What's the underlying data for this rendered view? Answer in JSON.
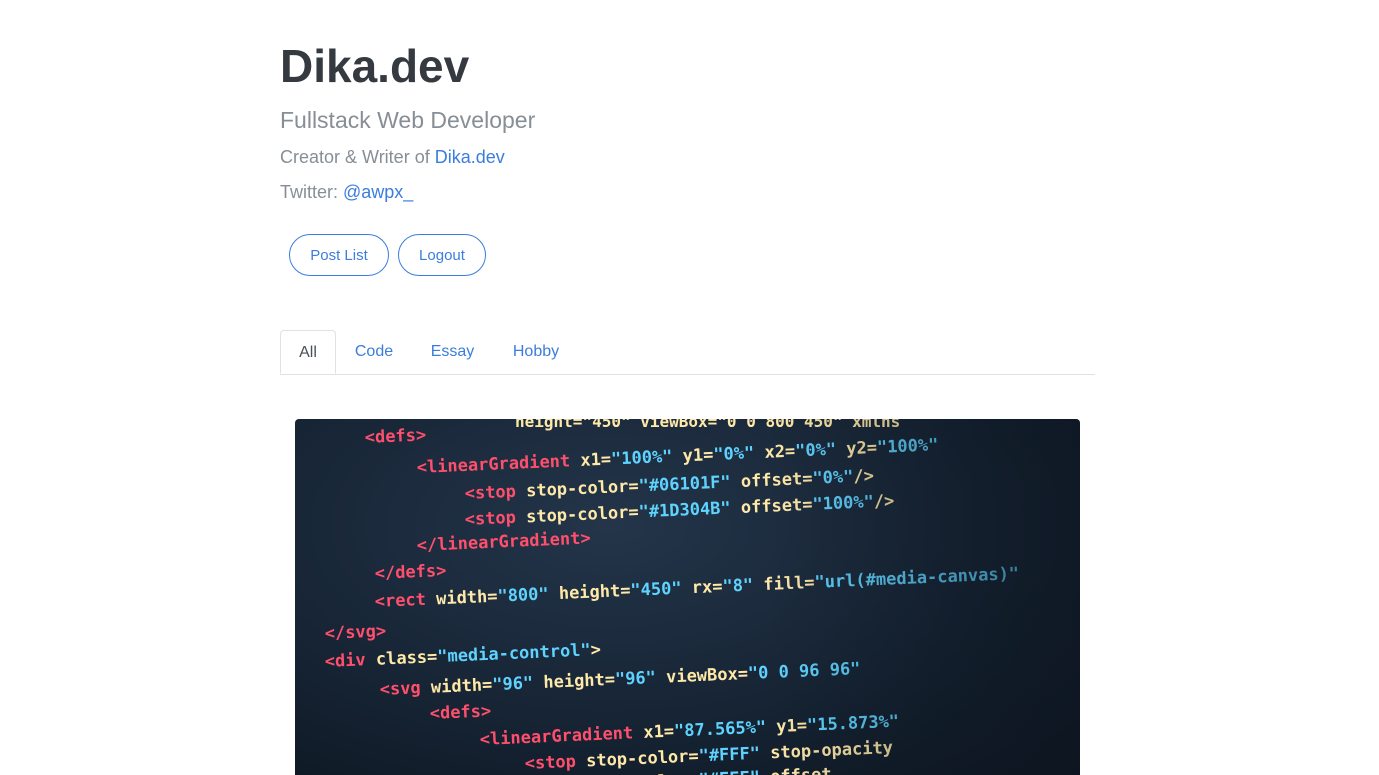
{
  "header": {
    "title": "Dika.dev",
    "subtitle": "Fullstack Web Developer",
    "creator_prefix": "Creator & Writer of ",
    "creator_link": "Dika.dev",
    "twitter_prefix": "Twitter: ",
    "twitter_handle": "@awpx_"
  },
  "buttons": {
    "post_list": "Post List",
    "logout": "Logout"
  },
  "tabs": [
    {
      "label": "All",
      "active": true
    },
    {
      "label": "Code",
      "active": false
    },
    {
      "label": "Essay",
      "active": false
    },
    {
      "label": "Hobby",
      "active": false
    }
  ],
  "post_image": {
    "lines": [
      {
        "tag": "<defs>",
        "rest": ""
      },
      {
        "tag": "<linearGradient",
        "rest": " x1=\"100%\" y1=\"0%\" x2=\"0%\" y2=\"100%\""
      },
      {
        "tag": "<stop",
        "rest": " stop-color=\"#06101F\" offset=\"0%\"/>"
      },
      {
        "tag": "<stop",
        "rest": " stop-color=\"#1D304B\" offset=\"100%\"/>"
      },
      {
        "tag": "</linearGradient>",
        "rest": ""
      },
      {
        "tag": "</defs>",
        "rest": ""
      },
      {
        "tag": "<rect",
        "rest": " width=\"800\" height=\"450\" rx=\"8\" fill=\"url(#media-canvas)\""
      },
      {
        "tag": "</svg>",
        "rest": ""
      },
      {
        "tag": "<div",
        "rest": " class=\"media-control\">"
      },
      {
        "tag": "<svg",
        "rest": " width=\"96\" height=\"96\" viewBox=\"0 0 96 96\""
      },
      {
        "tag": "<defs>",
        "rest": ""
      },
      {
        "tag": "<linearGradient",
        "rest": " x1=\"87.565%\" y1=\"15.873%\""
      },
      {
        "tag": "<stop",
        "rest": " stop-color=\"#FFF\" stop-opacity"
      },
      {
        "tag": "<stop",
        "rest": " stop-color=\"#FFF\" offset"
      }
    ],
    "top_line": "height=\"450\" viewBox=\"0 0 800 450\" xmlns"
  },
  "colors": {
    "accent": "#3b7ddd",
    "title": "#343a40",
    "muted": "#868e96",
    "code_tag": "#ff4f6d",
    "code_attr": "#ffe9a8",
    "code_value": "#5fd3ff"
  }
}
